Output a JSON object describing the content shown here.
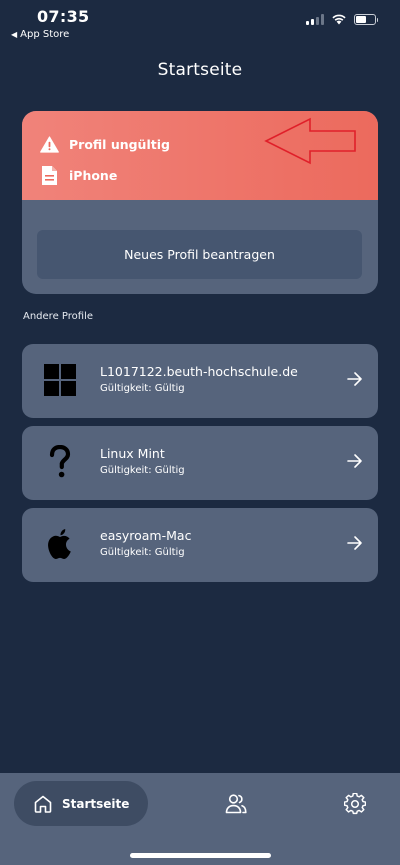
{
  "status_bar": {
    "time": "07:35",
    "back_label": "App Store"
  },
  "header": {
    "title": "Startseite"
  },
  "current_profile": {
    "status_label": "Profil ungültig",
    "device_label": "iPhone",
    "request_button_label": "Neues Profil beantragen",
    "alert_color": "#ec6a5d",
    "annotation_arrow_color": "#e0202a"
  },
  "other_profiles": {
    "section_label": "Andere Profile",
    "items": [
      {
        "icon": "windows-icon",
        "name": "L1017122.beuth-hochschule.de",
        "validity": "Gültigkeit: Gültig"
      },
      {
        "icon": "question-mark-icon",
        "name": "Linux Mint",
        "validity": "Gültigkeit: Gültig"
      },
      {
        "icon": "apple-icon",
        "name": "easyroam-Mac",
        "validity": "Gültigkeit: Gültig"
      }
    ]
  },
  "bottom_nav": {
    "items": [
      {
        "icon": "home-icon",
        "label": "Startseite",
        "active": true
      },
      {
        "icon": "people-icon",
        "label": ""
      },
      {
        "icon": "gear-icon",
        "label": ""
      }
    ]
  }
}
